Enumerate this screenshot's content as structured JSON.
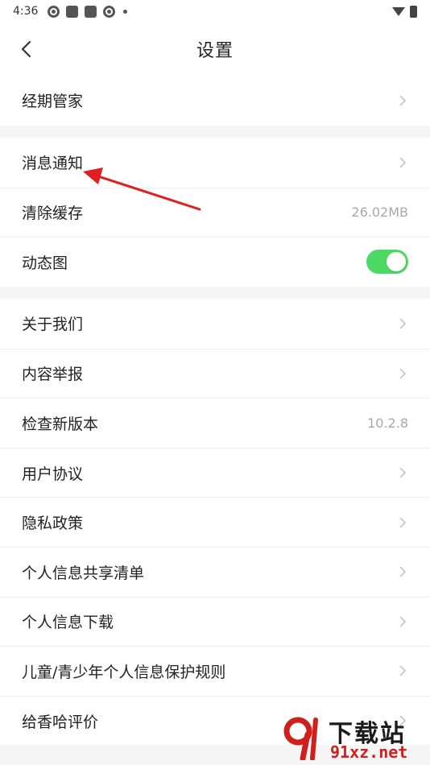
{
  "status_bar": {
    "time": "4:36",
    "icons": [
      "app-round-icon",
      "app-square-icon",
      "app-square-icon",
      "app-round-icon",
      "notification-dot-icon"
    ],
    "right_icons": [
      "wifi-icon",
      "battery-icon"
    ]
  },
  "header": {
    "title": "设置",
    "back_icon": "chevron-left-icon"
  },
  "sections": [
    {
      "items": [
        {
          "label": "经期管家",
          "type": "link"
        }
      ]
    },
    {
      "items": [
        {
          "label": "消息通知",
          "type": "link"
        },
        {
          "label": "清除缓存",
          "type": "value",
          "value": "26.02MB"
        },
        {
          "label": "动态图",
          "type": "toggle",
          "checked": true
        }
      ]
    },
    {
      "items": [
        {
          "label": "关于我们",
          "type": "link"
        },
        {
          "label": "内容举报",
          "type": "link"
        },
        {
          "label": "检查新版本",
          "type": "value",
          "value": "10.2.8"
        },
        {
          "label": "用户协议",
          "type": "link"
        },
        {
          "label": "隐私政策",
          "type": "link"
        },
        {
          "label": "个人信息共享清单",
          "type": "link"
        },
        {
          "label": "个人信息下载",
          "type": "link"
        },
        {
          "label": "儿童/青少年个人信息保护规则",
          "type": "link"
        },
        {
          "label": "给香哈评价",
          "type": "link"
        }
      ]
    }
  ],
  "watermark": {
    "top_text": "下载站",
    "bottom_text": "91xz.net"
  },
  "colors": {
    "toggle_on": "#4cd964",
    "annotation_arrow": "#e02020",
    "chevron": "#c4c4c4",
    "watermark_red": "#d0201b"
  }
}
